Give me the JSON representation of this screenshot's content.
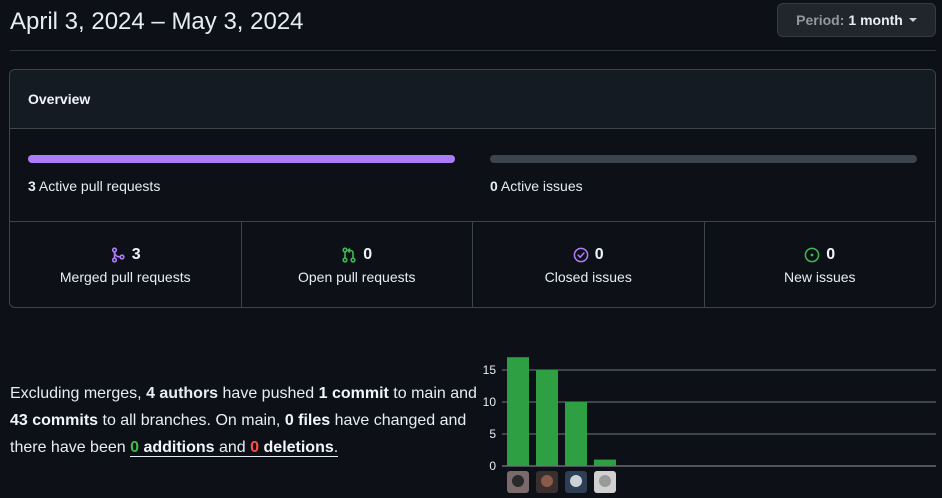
{
  "header": {
    "date_range": "April 3, 2024 – May 3, 2024",
    "period_prefix": "Period:",
    "period_value": "1 month"
  },
  "overview": {
    "title": "Overview",
    "bars": [
      {
        "count": "3",
        "label": "Active pull requests",
        "fill_fraction": 1.0,
        "color": "#ab7df8"
      },
      {
        "count": "0",
        "label": "Active issues",
        "fill_fraction": 0.0,
        "color": "#ab7df8"
      }
    ],
    "stats": [
      {
        "count": "3",
        "label": "Merged pull requests",
        "icon": "merge-icon",
        "color": "#ab7df8"
      },
      {
        "count": "0",
        "label": "Open pull requests",
        "icon": "pull-request-icon",
        "color": "#3fb950"
      },
      {
        "count": "0",
        "label": "Closed issues",
        "icon": "issue-closed-icon",
        "color": "#ab7df8"
      },
      {
        "count": "0",
        "label": "New issues",
        "icon": "issue-opened-icon",
        "color": "#3fb950"
      }
    ]
  },
  "summary": {
    "part1": "Excluding merges, ",
    "authors": "4 authors",
    "part2": " have pushed ",
    "commits_main": "1 commit",
    "part3": " to main and ",
    "commits_all": "43 commits",
    "part4": " to all branches. On main, ",
    "files": "0 files",
    "part5": " have changed and there have been ",
    "additions_count": "0",
    "additions_word": "additions",
    "part6": " and ",
    "deletions_count": "0",
    "deletions_word": "deletions",
    "part7": "."
  },
  "chart_data": {
    "type": "bar",
    "categories": [
      "author-1",
      "author-2",
      "author-3",
      "author-4"
    ],
    "values": [
      17,
      15,
      10,
      1
    ],
    "yticks": [
      0,
      5,
      10,
      15
    ],
    "ylim": [
      0,
      18
    ],
    "bar_color": "#2ea043",
    "grid": true
  }
}
